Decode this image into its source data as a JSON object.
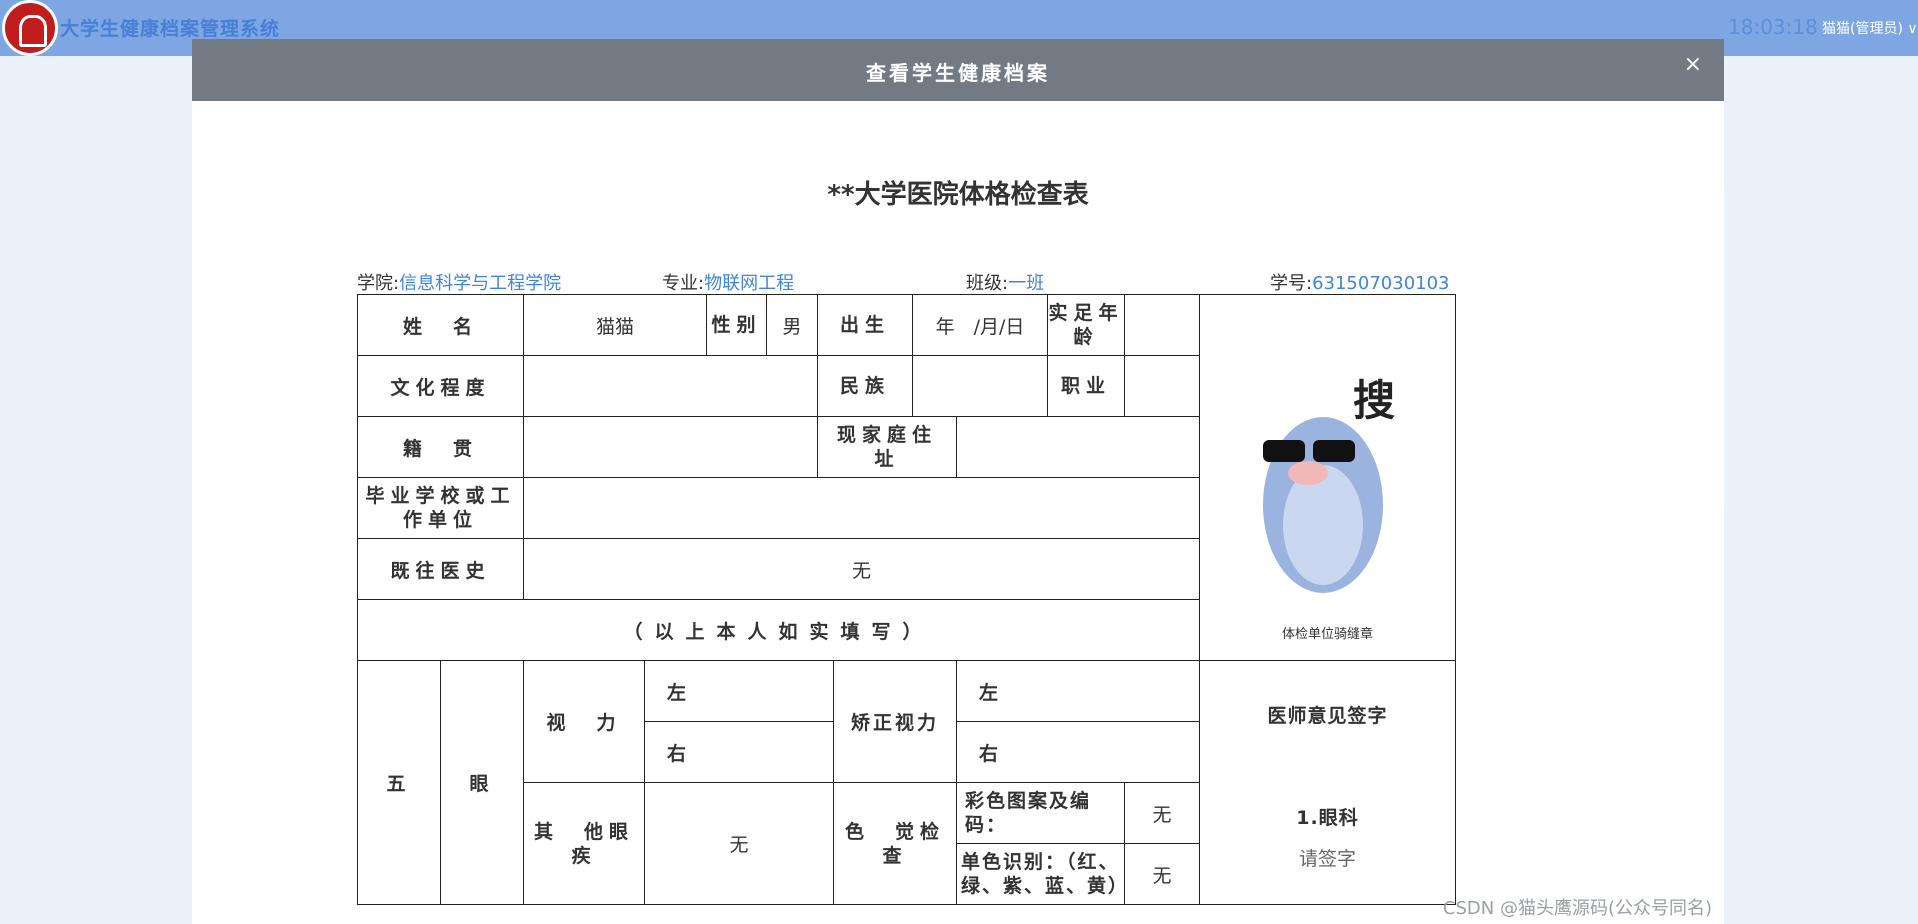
{
  "app": {
    "title": "大学生健康档案管理系统",
    "clock": "18:03:18",
    "user": "猫猫(管理员)",
    "user_arrow": "∨"
  },
  "modal": {
    "title": "查看学生健康档案",
    "close": "×"
  },
  "form": {
    "title": "**大学医院体格检查表",
    "college_label": "学院:",
    "college": "信息科学与工程学院",
    "major_label": "专业:",
    "major": "物联网工程",
    "class_label": "班级:",
    "class": "一班",
    "sid_label": "学号:",
    "sid": "631507030103"
  },
  "labels": {
    "name": "姓　名",
    "gender": "性别",
    "birth": "出生",
    "birth_value": "年　/月/日",
    "age": "实足年龄",
    "education": "文化程度",
    "ethnic": "民族",
    "job": "职业",
    "native": "籍　贯",
    "address": "现家庭住　址",
    "school": "毕业学校或工作单位",
    "history": "既往医史",
    "honest": "（以上本人如实填写）",
    "five": "五",
    "eye": "眼",
    "vision": "视　力",
    "left": "左",
    "right": "右",
    "corrected": "矫正视力",
    "other": "其　他眼　疾",
    "color": "色　觉检　查",
    "color_pattern": "彩色图案及编码：",
    "mono": "单色识别：（红、绿、紫、蓝、黄）",
    "stamp": "体检单位骑缝章",
    "doctor": "医师意见签字",
    "eye_dept": "1.眼科",
    "sign_here": "请签字"
  },
  "values": {
    "name": "猫猫",
    "gender": "男",
    "history": "无",
    "other_eye": "无",
    "color_pattern": "无",
    "mono": "无"
  },
  "watermark": "CSDN @猫头鹰源码(公众号同名)"
}
